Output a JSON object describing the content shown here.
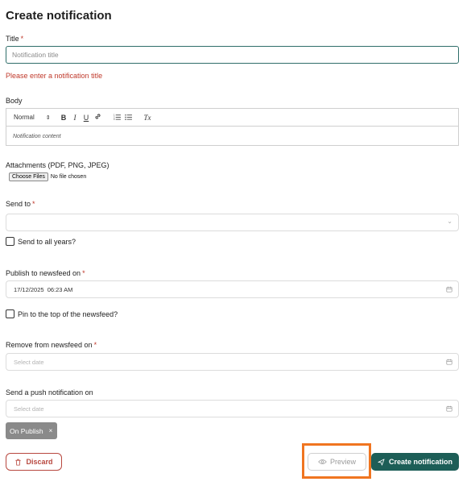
{
  "page": {
    "title": "Create notification"
  },
  "title_field": {
    "label": "Title",
    "required_mark": "*",
    "placeholder": "Notification title",
    "value": "",
    "error": "Please enter a notification title"
  },
  "body_field": {
    "label": "Body",
    "format_select": "Normal",
    "toolbar_buttons": {
      "bold": "B",
      "italic": "I",
      "underline": "U",
      "clear": "Tx"
    },
    "content_placeholder": "Notification content"
  },
  "attachments": {
    "label": "Attachments (PDF, PNG, JPEG)",
    "button": "Choose Files",
    "status": "No file chosen"
  },
  "send_to": {
    "label": "Send to",
    "required_mark": "*",
    "value": "",
    "all_years_label": "Send to all years?"
  },
  "publish": {
    "label": "Publish to newsfeed on",
    "required_mark": "*",
    "value": "17/12/2025  06:23 AM",
    "pin_label": "Pin to the top of the newsfeed?"
  },
  "remove": {
    "label": "Remove from newsfeed on",
    "required_mark": "*",
    "placeholder": "Select date"
  },
  "push": {
    "label": "Send a push notification on",
    "placeholder": "Select date",
    "chip": "On Publish",
    "chip_remove": "×"
  },
  "actions": {
    "discard": "Discard",
    "preview": "Preview",
    "create": "Create notification",
    "highlight_color": "#f07520",
    "primary_color": "#1d5e57",
    "danger_color": "#b8483f"
  }
}
